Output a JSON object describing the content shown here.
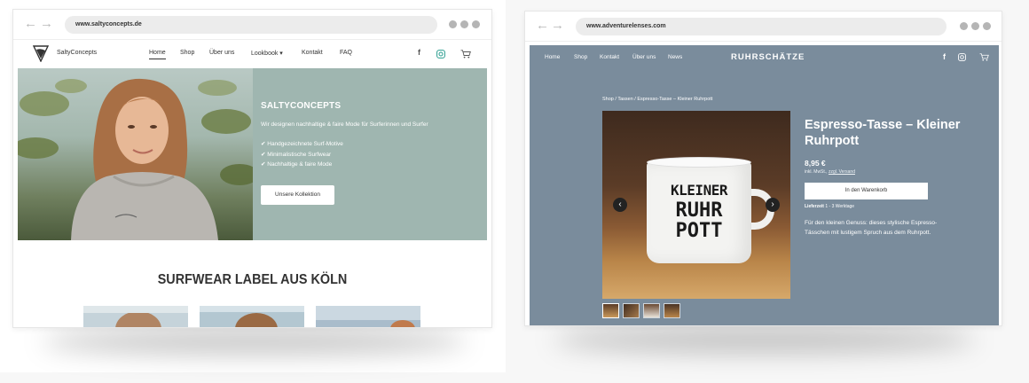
{
  "left_window": {
    "url": "www.saltyconcepts.de",
    "brand": "SaltyConcepts",
    "nav": [
      "Home",
      "Shop",
      "Über uns",
      "Lookbook ▾",
      "Kontakt",
      "FAQ"
    ],
    "nav_icons": [
      "facebook-icon",
      "instagram-icon",
      "cart-icon"
    ],
    "hero": {
      "title": "SALTYCONCEPTS",
      "subtitle": "Wir designen nachhaltige & faire Mode für Surferinnen und Surfer",
      "bullets": [
        "✔ Handgezeichnete Surf-Motive",
        "✔ Minimalistische Surfwear",
        "✔ Nachhaltige & faire Mode"
      ],
      "button": "Unsere Kollektion"
    },
    "section_title": "SURFWEAR LABEL AUS KÖLN"
  },
  "right_window": {
    "url": "www.adventurelenses.com",
    "nav": [
      "Home",
      "Shop",
      "Kontakt",
      "Über uns",
      "News"
    ],
    "brand": "RUHRSCHÄTZE",
    "breadcrumb": "Shop  /  Tassen  /  Espresso-Tasse – Kleiner Ruhrpott",
    "mug_text": [
      "KLEINER",
      "RUHR",
      "POTT"
    ],
    "product": {
      "title": "Espresso-Tasse – Kleiner Ruhrpott",
      "price": "8,95 €",
      "tax_prefix": "inkl. MwSt.,",
      "tax_link": "zzgl. Versand",
      "cart_button": "In den Warenkorb",
      "delivery_label": "Lieferzeit",
      "delivery_value": "1 - 3 Werktage",
      "description": "Für den kleinen Genuss: dieses stylische Espresso-Tässchen mit lustigem Spruch aus dem Ruhrpott."
    }
  },
  "colors": {
    "left_panel": "#9fb6b0",
    "right_site": "#7a8c9c"
  }
}
